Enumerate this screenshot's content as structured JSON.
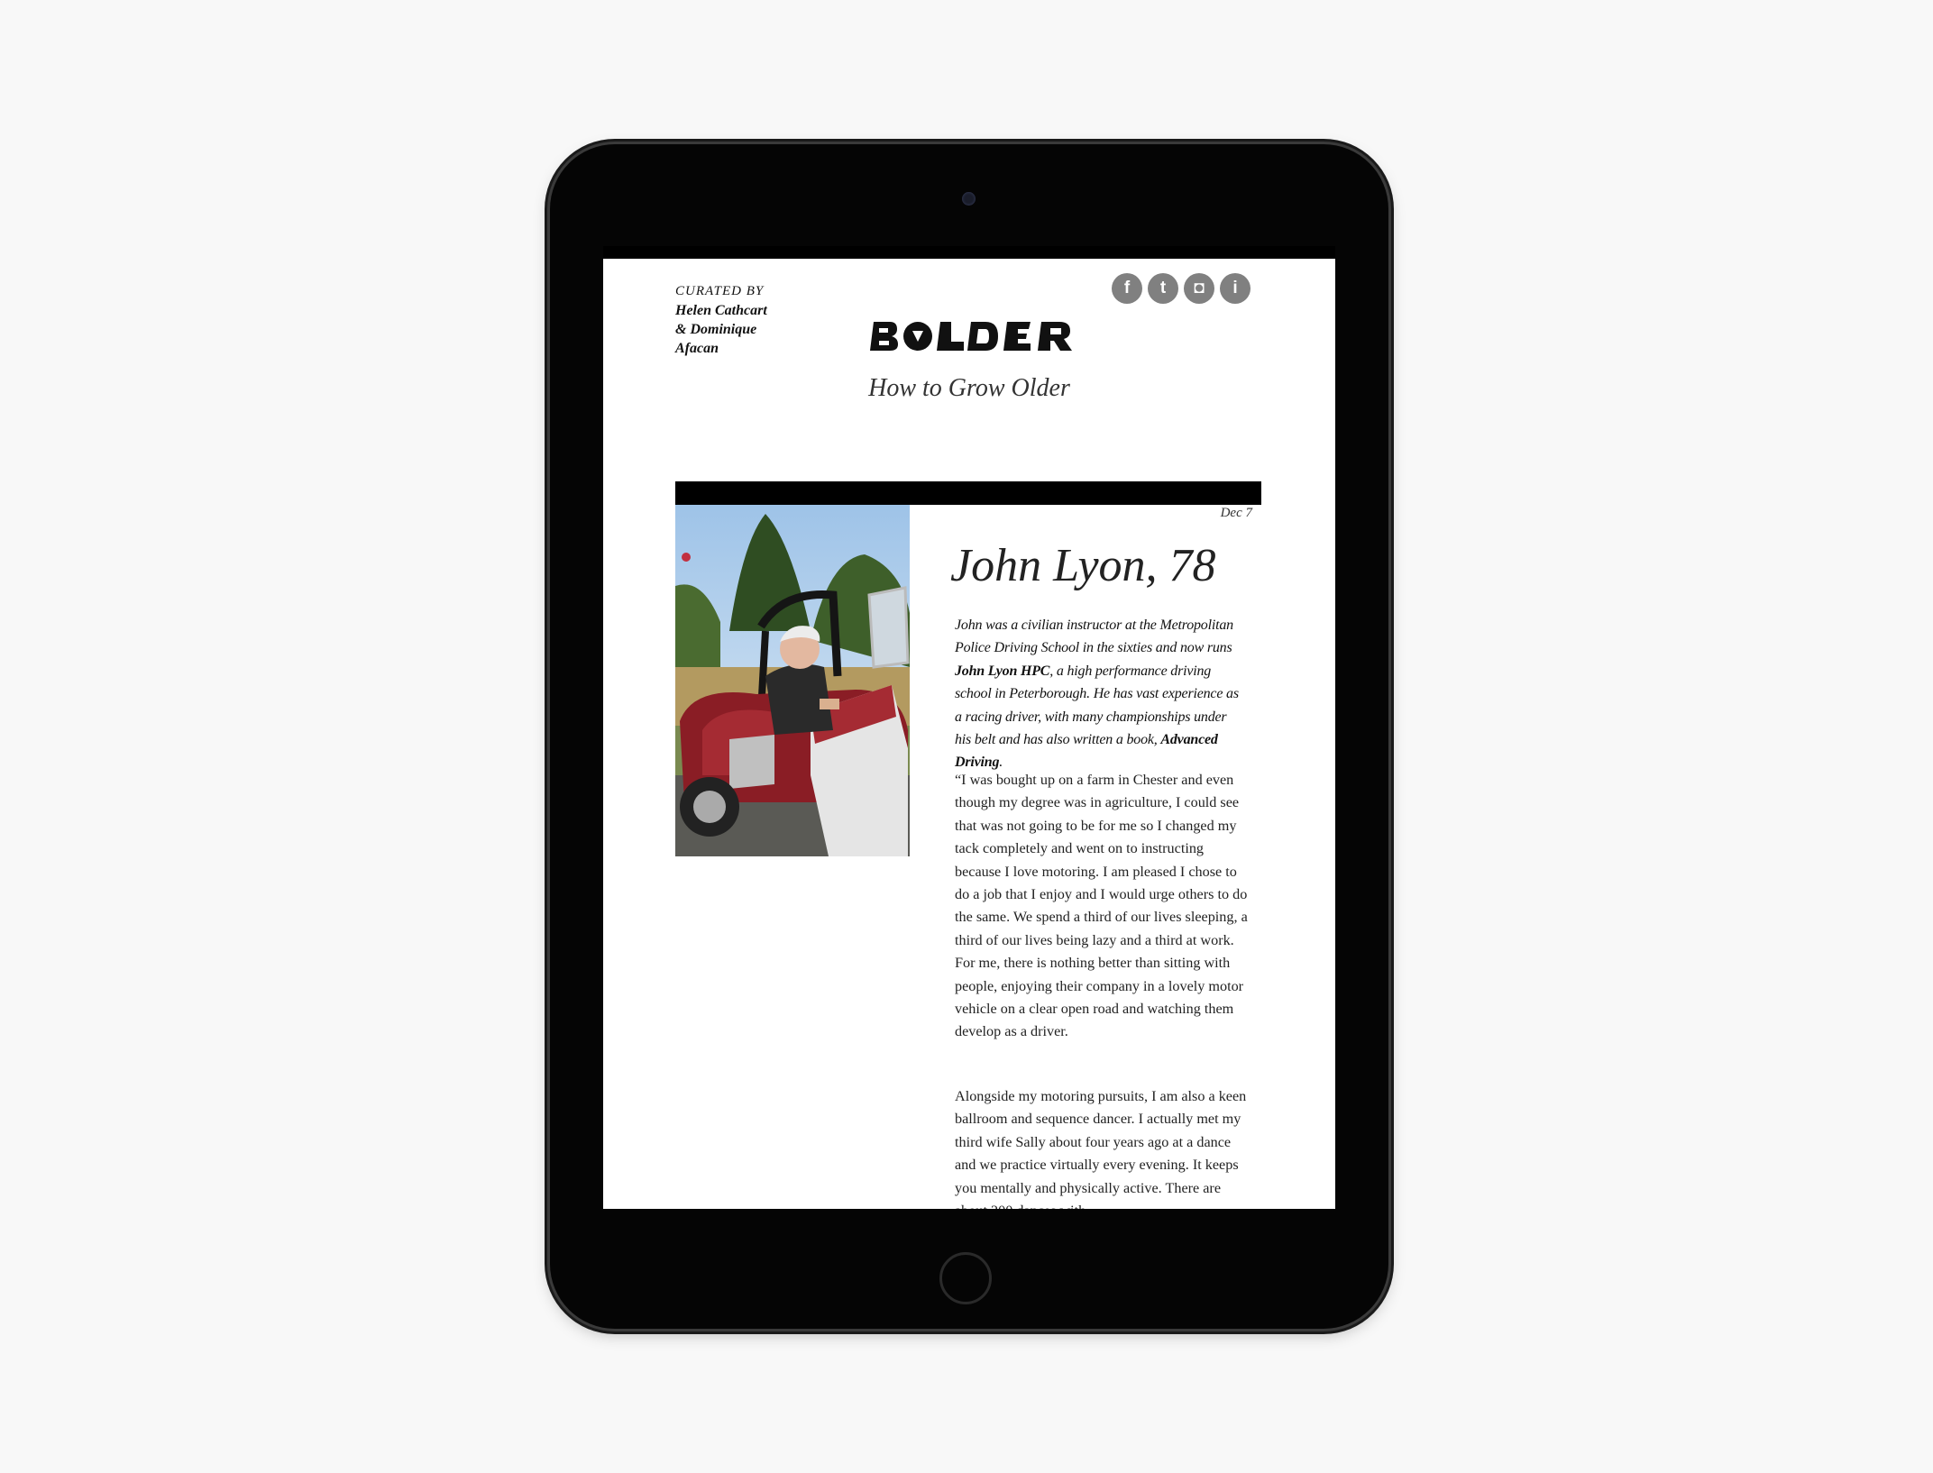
{
  "header": {
    "curated_label": "CURATED BY",
    "curators": [
      "Helen Cathcart",
      "& Dominique",
      "Afacan"
    ],
    "logo_text": "BOLDER",
    "tagline": "How to Grow Older",
    "social": [
      {
        "icon": "facebook-icon",
        "glyph": "f"
      },
      {
        "icon": "twitter-icon",
        "glyph": "t"
      },
      {
        "icon": "instagram-icon",
        "glyph": "◘"
      },
      {
        "icon": "info-icon",
        "glyph": "i"
      }
    ]
  },
  "article": {
    "date": "Dec 7",
    "title": "John Lyon, 78",
    "intro_1": "John was a civilian instructor at the Metropolitan Police Driving School in the sixties and now runs ",
    "intro_link_1": "John Lyon HPC",
    "intro_2": ", a high performance driving school in Peterborough. He has vast experience as a racing driver, with many championships under his belt and has also written a book, ",
    "intro_link_2": "Advanced Driving",
    "intro_3": ".",
    "paragraph_1": "“I was bought up on a farm in Chester and even though my degree was in agriculture, I could see that was not going to be for me so I changed my tack completely and went on to instructing because I love motoring. I am pleased I chose to do a job that I enjoy and I would urge others to do the same. We spend a third of our lives sleeping, a third of our lives being lazy and a third at work. For me, there is nothing better than sitting with people, enjoying their company in a lovely motor vehicle on a clear open road and watching them develop as a driver.",
    "paragraph_2": "Alongside my motoring pursuits, I am also a keen ballroom and sequence dancer. I actually met my third wife Sally about four years ago at a dance and we practice virtually every evening. It keeps you mentally and physically active. There are about 200 dances with"
  },
  "colors": {
    "device": "#050505",
    "page_bg": "#f8f8f8",
    "screen_bg": "#ffffff",
    "social_icon_bg": "#808080"
  }
}
